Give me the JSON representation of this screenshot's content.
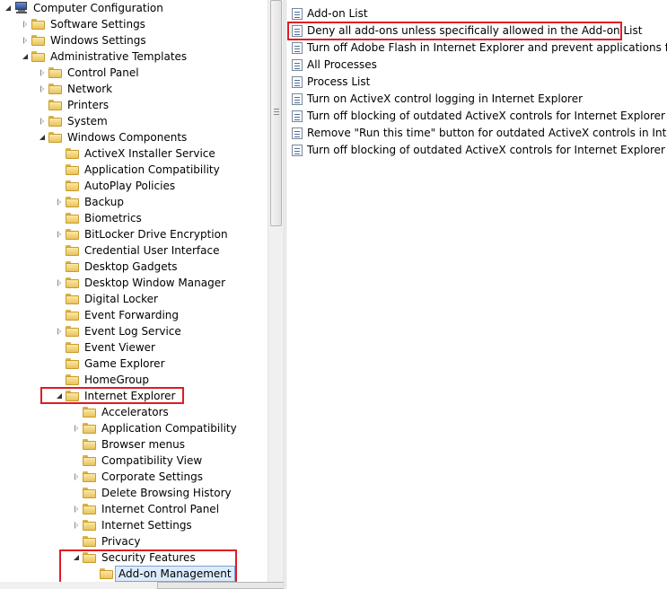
{
  "tree": {
    "root": "Computer Configuration",
    "items": [
      {
        "label": "Software Settings",
        "level": 1,
        "expander": "right"
      },
      {
        "label": "Windows Settings",
        "level": 1,
        "expander": "right"
      },
      {
        "label": "Administrative Templates",
        "level": 1,
        "expander": "down"
      },
      {
        "label": "Control Panel",
        "level": 2,
        "expander": "right"
      },
      {
        "label": "Network",
        "level": 2,
        "expander": "right"
      },
      {
        "label": "Printers",
        "level": 2,
        "expander": "none"
      },
      {
        "label": "System",
        "level": 2,
        "expander": "right"
      },
      {
        "label": "Windows Components",
        "level": 2,
        "expander": "down"
      },
      {
        "label": "ActiveX Installer Service",
        "level": 3,
        "expander": "none"
      },
      {
        "label": "Application Compatibility",
        "level": 3,
        "expander": "none"
      },
      {
        "label": "AutoPlay Policies",
        "level": 3,
        "expander": "none"
      },
      {
        "label": "Backup",
        "level": 3,
        "expander": "right"
      },
      {
        "label": "Biometrics",
        "level": 3,
        "expander": "none"
      },
      {
        "label": "BitLocker Drive Encryption",
        "level": 3,
        "expander": "right"
      },
      {
        "label": "Credential User Interface",
        "level": 3,
        "expander": "none"
      },
      {
        "label": "Desktop Gadgets",
        "level": 3,
        "expander": "none"
      },
      {
        "label": "Desktop Window Manager",
        "level": 3,
        "expander": "right"
      },
      {
        "label": "Digital Locker",
        "level": 3,
        "expander": "none"
      },
      {
        "label": "Event Forwarding",
        "level": 3,
        "expander": "none"
      },
      {
        "label": "Event Log Service",
        "level": 3,
        "expander": "right"
      },
      {
        "label": "Event Viewer",
        "level": 3,
        "expander": "none"
      },
      {
        "label": "Game Explorer",
        "level": 3,
        "expander": "none"
      },
      {
        "label": "HomeGroup",
        "level": 3,
        "expander": "none"
      },
      {
        "label": "Internet Explorer",
        "level": 3,
        "expander": "down",
        "highlight": true
      },
      {
        "label": "Accelerators",
        "level": 4,
        "expander": "none"
      },
      {
        "label": "Application Compatibility",
        "level": 4,
        "expander": "right"
      },
      {
        "label": "Browser menus",
        "level": 4,
        "expander": "none"
      },
      {
        "label": "Compatibility View",
        "level": 4,
        "expander": "none"
      },
      {
        "label": "Corporate Settings",
        "level": 4,
        "expander": "right"
      },
      {
        "label": "Delete Browsing History",
        "level": 4,
        "expander": "none"
      },
      {
        "label": "Internet Control Panel",
        "level": 4,
        "expander": "right"
      },
      {
        "label": "Internet Settings",
        "level": 4,
        "expander": "right"
      },
      {
        "label": "Privacy",
        "level": 4,
        "expander": "none"
      },
      {
        "label": "Security Features",
        "level": 4,
        "expander": "down",
        "highlight": true
      },
      {
        "label": "Add-on Management",
        "level": 5,
        "expander": "none",
        "selected": true,
        "highlight": true
      }
    ]
  },
  "settings": {
    "items": [
      {
        "label": "Add-on List"
      },
      {
        "label": "Deny all add-ons unless specifically allowed in the Add-on List",
        "highlight": true
      },
      {
        "label": "Turn off Adobe Flash in Internet Explorer and prevent applications from ..."
      },
      {
        "label": "All Processes"
      },
      {
        "label": "Process List"
      },
      {
        "label": "Turn on ActiveX control logging in Internet Explorer"
      },
      {
        "label": "Turn off blocking of outdated ActiveX controls for Internet Explorer"
      },
      {
        "label": "Remove \"Run this time\" button for outdated ActiveX controls in Internet ..."
      },
      {
        "label": "Turn off blocking of outdated ActiveX controls for Internet Explorer on s..."
      }
    ]
  },
  "icons": {
    "root": "computer-icon",
    "folder": "folder-icon",
    "setting": "policy-setting-icon",
    "expand": "expand-arrow-icon",
    "collapse": "collapse-arrow-icon"
  },
  "colors": {
    "highlight_box": "#e01b24",
    "selection_bg": "#dcebfc",
    "selection_border": "#7da2ce"
  }
}
